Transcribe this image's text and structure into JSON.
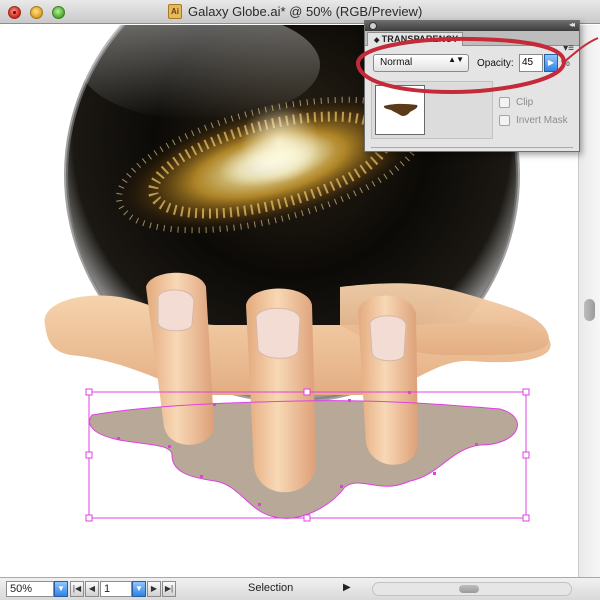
{
  "window": {
    "title": "Galaxy Globe.ai* @ 50% (RGB/Preview)",
    "doc_icon_glyph": "Ai"
  },
  "panel": {
    "tab_label": "TRANSPARENCY",
    "tab_arrows": "◆",
    "menu_glyph": "▾≡",
    "collapse_glyph": "◂◂",
    "blend_mode": "Normal",
    "blend_arrows": "▲▼",
    "opacity_label": "Opacity:",
    "opacity_value": "45",
    "opacity_arrow": "▶",
    "percent_sign": "%",
    "clip_label": "Clip",
    "invert_mask_label": "Invert Mask"
  },
  "statusbar": {
    "zoom": "50%",
    "zoom_arrow": "▼",
    "first_glyph": "|◀",
    "prev_glyph": "◀",
    "page": "1",
    "page_arrow": "▼",
    "next_glyph": "▶",
    "last_glyph": "▶|",
    "tool": "Selection",
    "tool_arrow": "▶"
  },
  "colors": {
    "selection": "#e040e0",
    "callout": "#c42a3a",
    "shadow": "#b8a898",
    "skin": "#f0c9a0"
  }
}
